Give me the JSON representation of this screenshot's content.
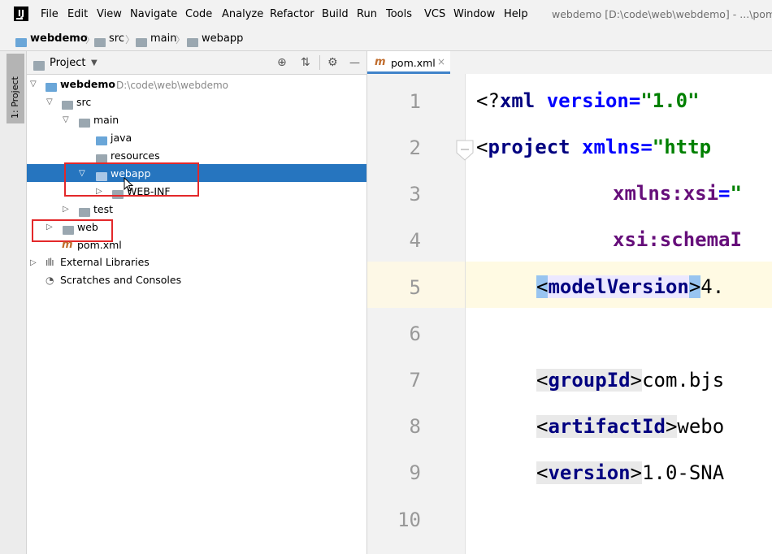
{
  "menu": {
    "items": [
      "File",
      "Edit",
      "View",
      "Navigate",
      "Code",
      "Analyze",
      "Refactor",
      "Build",
      "Run",
      "Tools",
      "VCS",
      "Window",
      "Help"
    ],
    "window_title": "webdemo [D:\\code\\web\\webdemo] - ...\\pom"
  },
  "breadcrumb": [
    "webdemo",
    "src",
    "main",
    "webapp"
  ],
  "toolstrip": {
    "project_tab": "1: Project"
  },
  "project_panel": {
    "title": "Project",
    "tree": {
      "root_name": "webdemo",
      "root_path": "D:\\code\\web\\webdemo",
      "src": "src",
      "main": "main",
      "java": "java",
      "resources": "resources",
      "webapp": "webapp",
      "webinf": "WEB-INF",
      "test": "test",
      "web": "web",
      "pom": "pom.xml",
      "ext_libs": "External Libraries",
      "scratches": "Scratches and Consoles"
    }
  },
  "editor": {
    "tab_label": "pom.xml",
    "line_numbers": [
      "1",
      "2",
      "3",
      "4",
      "5",
      "6",
      "7",
      "8",
      "9",
      "10"
    ],
    "lines": {
      "l1_open": "<?",
      "l1_tag": "xml",
      "l1_attr": " version",
      "l1_eq": "=",
      "l1_val": "\"1.0\"",
      "l2_open": "<",
      "l2_tag": "project",
      "l2_attr": " xmlns",
      "l2_eq": "=",
      "l2_val": "\"http",
      "l3_ns": "xmlns:xsi",
      "l3_eq": "=",
      "l3_val": "\"",
      "l4_ns": "xsi:schemaI",
      "l5_lt": "<",
      "l5_tag": "modelVersion",
      "l5_gt": ">",
      "l5_text": "4.",
      "l7_lt": "<",
      "l7_tag": "groupId",
      "l7_gt": ">",
      "l7_text": "com.bjs",
      "l8_lt": "<",
      "l8_tag": "artifactId",
      "l8_gt": ">",
      "l8_text": "webo",
      "l9_lt": "<",
      "l9_tag": "version",
      "l9_gt": ">",
      "l9_text": "1.0-SNA"
    }
  }
}
